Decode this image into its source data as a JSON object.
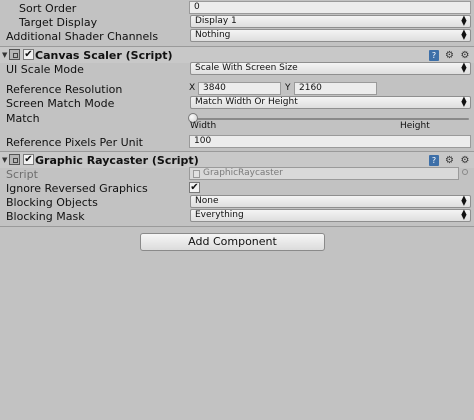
{
  "canvas_rows": {
    "sort_order": {
      "label": "Sort Order",
      "value": "0"
    },
    "target_display": {
      "label": "Target Display",
      "value": "Display 1"
    },
    "additional_shader_channels": {
      "label": "Additional Shader Channels",
      "value": "Nothing"
    }
  },
  "canvas_scaler": {
    "title": "Canvas Scaler (Script)",
    "ui_scale_mode": {
      "label": "UI Scale Mode",
      "value": "Scale With Screen Size"
    },
    "reference_resolution": {
      "label": "Reference Resolution",
      "x_label": "X",
      "x_value": "3840",
      "y_label": "Y",
      "y_value": "2160"
    },
    "screen_match_mode": {
      "label": "Screen Match Mode",
      "value": "Match Width Or Height"
    },
    "match": {
      "label": "Match",
      "left_label": "Width",
      "right_label": "Height",
      "level": 0
    },
    "reference_pixels_per_unit": {
      "label": "Reference Pixels Per Unit",
      "value": "100"
    }
  },
  "graphic_raycaster": {
    "title": "Graphic Raycaster (Script)",
    "script": {
      "label": "Script",
      "value": "GraphicRaycaster"
    },
    "ignore_reversed_graphics": {
      "label": "Ignore Reversed Graphics",
      "checked": true
    },
    "blocking_objects": {
      "label": "Blocking Objects",
      "value": "None"
    },
    "blocking_mask": {
      "label": "Blocking Mask",
      "value": "Everything"
    }
  },
  "header_icons": {
    "help": "?",
    "settings": "⚙"
  },
  "add_component_label": "Add Component"
}
